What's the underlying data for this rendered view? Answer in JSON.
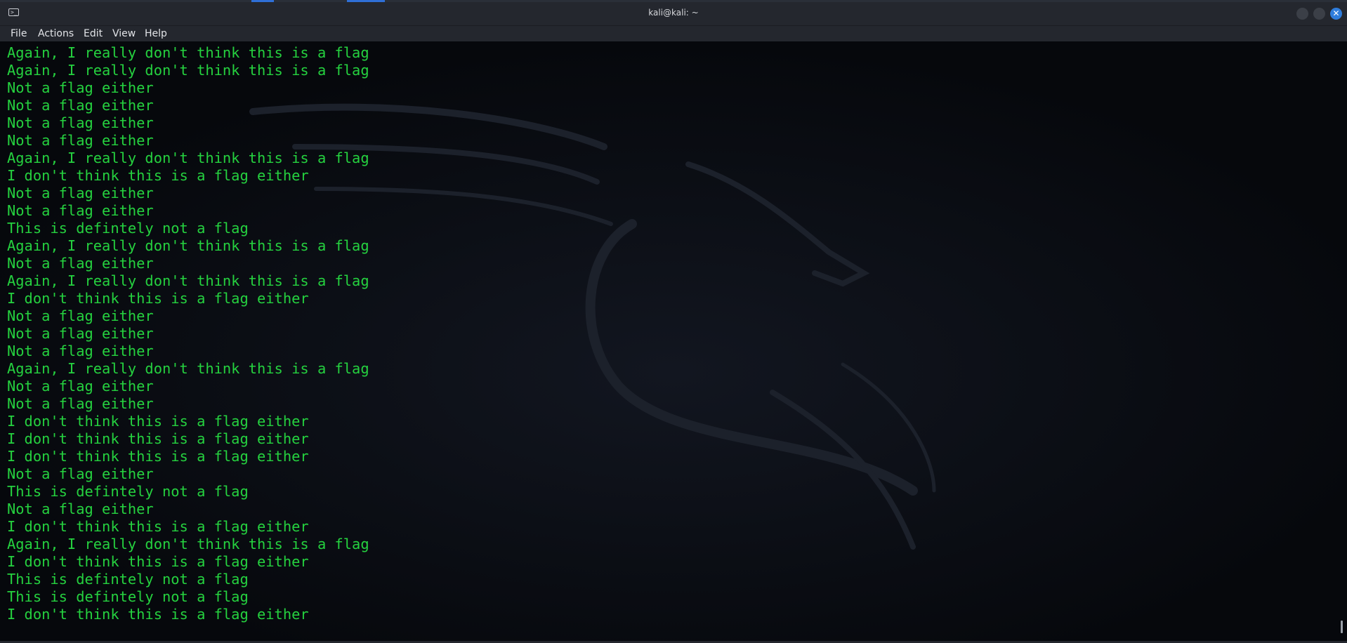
{
  "window": {
    "title": "kali@kali: ~"
  },
  "menubar": {
    "items": [
      "File",
      "Actions",
      "Edit",
      "View",
      "Help"
    ]
  },
  "icons": {
    "app_icon": "terminal-icon",
    "minimize": "minimize-icon",
    "maximize": "maximize-icon",
    "close": "close-icon"
  },
  "colors": {
    "terminal_text": "#25d13f",
    "terminal_bg": "#06080c",
    "close_button": "#2f7ddc"
  },
  "terminal": {
    "lines": [
      "Again, I really don't think this is a flag",
      "Again, I really don't think this is a flag",
      "Not a flag either",
      "Not a flag either",
      "Not a flag either",
      "Not a flag either",
      "Again, I really don't think this is a flag",
      "I don't think this is a flag either",
      "Not a flag either",
      "Not a flag either",
      "This is defintely not a flag",
      "Again, I really don't think this is a flag",
      "Not a flag either",
      "Again, I really don't think this is a flag",
      "I don't think this is a flag either",
      "Not a flag either",
      "Not a flag either",
      "Not a flag either",
      "Again, I really don't think this is a flag",
      "Not a flag either",
      "Not a flag either",
      "I don't think this is a flag either",
      "I don't think this is a flag either",
      "I don't think this is a flag either",
      "Not a flag either",
      "This is defintely not a flag",
      "Not a flag either",
      "I don't think this is a flag either",
      "Again, I really don't think this is a flag",
      "I don't think this is a flag either",
      "This is defintely not a flag",
      "This is defintely not a flag",
      "I don't think this is a flag either"
    ]
  }
}
